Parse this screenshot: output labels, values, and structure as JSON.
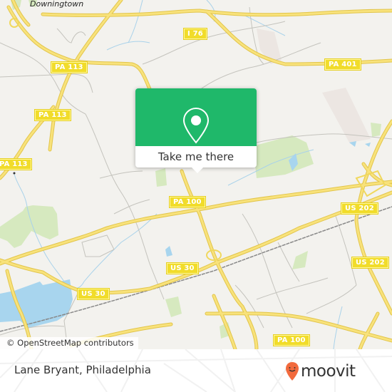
{
  "map": {
    "place_labels": [
      {
        "id": "downingtown",
        "text": "Downingtown"
      }
    ],
    "road_shields": [
      {
        "id": "i76",
        "text": "I 76"
      },
      {
        "id": "pa401",
        "text": "PA 401"
      },
      {
        "id": "pa113-a",
        "text": "PA 113"
      },
      {
        "id": "pa113-b",
        "text": "PA 113"
      },
      {
        "id": "pa113-c",
        "text": "PA 113"
      },
      {
        "id": "pa100-a",
        "text": "PA 100"
      },
      {
        "id": "us202-a",
        "text": "US 202"
      },
      {
        "id": "us30-a",
        "text": "US 30"
      },
      {
        "id": "us202-b",
        "text": "US 202"
      },
      {
        "id": "us30-b",
        "text": "US 30"
      },
      {
        "id": "pa100-b",
        "text": "PA 100"
      }
    ],
    "attribution": "© OpenStreetMap contributors",
    "colors": {
      "background": "#f3f2ee",
      "road_major": "#f7e07a",
      "road_casing": "#e5c84a",
      "road_minor": "#bdbdb8",
      "water": "#a8d5ee",
      "park": "#cfe6b0",
      "railway": "#777777"
    }
  },
  "popup": {
    "icon": "map-pin-icon",
    "button_label": "Take me there",
    "accent_color": "#1fb86a"
  },
  "footer": {
    "title": "Lane Bryant, Philadelphia",
    "brand": "moovit",
    "brand_color": "#f26a3d"
  }
}
